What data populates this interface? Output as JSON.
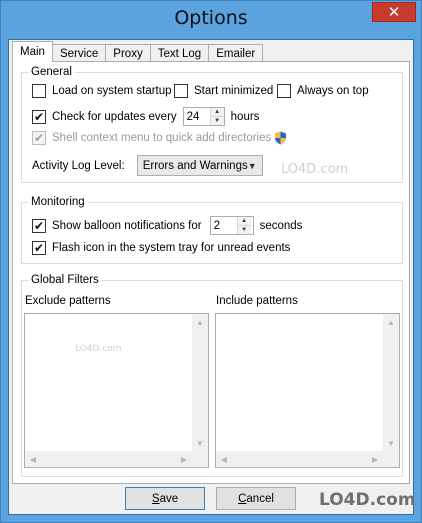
{
  "window": {
    "title": "Options",
    "close_glyph": "✕"
  },
  "tabs": [
    {
      "label": "Main",
      "active": true
    },
    {
      "label": "Service",
      "active": false
    },
    {
      "label": "Proxy",
      "active": false
    },
    {
      "label": "Text Log",
      "active": false
    },
    {
      "label": "Emailer",
      "active": false
    }
  ],
  "general": {
    "label": "General",
    "load_on_startup": {
      "label": "Load on system startup",
      "checked": false
    },
    "start_minimized": {
      "label": "Start minimized",
      "checked": false
    },
    "always_on_top": {
      "label": "Always on top",
      "checked": false
    },
    "check_updates": {
      "label": "Check for updates every",
      "checked": true,
      "value": "24",
      "unit": "hours"
    },
    "shell_menu": {
      "label": "Shell context menu to quick add directories",
      "checked": true,
      "disabled": true,
      "icon": "uac-shield-icon"
    },
    "activity_log": {
      "label": "Activity Log Level:",
      "value": "Errors and Warnings"
    }
  },
  "monitoring": {
    "label": "Monitoring",
    "balloon": {
      "label": "Show balloon notifications for",
      "checked": true,
      "value": "2",
      "unit": "seconds"
    },
    "flash_icon": {
      "label": "Flash icon in the system tray for unread events",
      "checked": true
    }
  },
  "global_filters": {
    "label": "Global Filters",
    "exclude": {
      "label": "Exclude patterns"
    },
    "include": {
      "label": "Include patterns"
    }
  },
  "buttons": {
    "save": "ave",
    "save_mnemonic": "S",
    "cancel": "ancel",
    "cancel_mnemonic": "C"
  },
  "watermark": {
    "text": "LO4D.com"
  },
  "colors": {
    "titlebar": "#5aa3df",
    "close": "#c73b2f",
    "accent": "#3c7fb1"
  }
}
